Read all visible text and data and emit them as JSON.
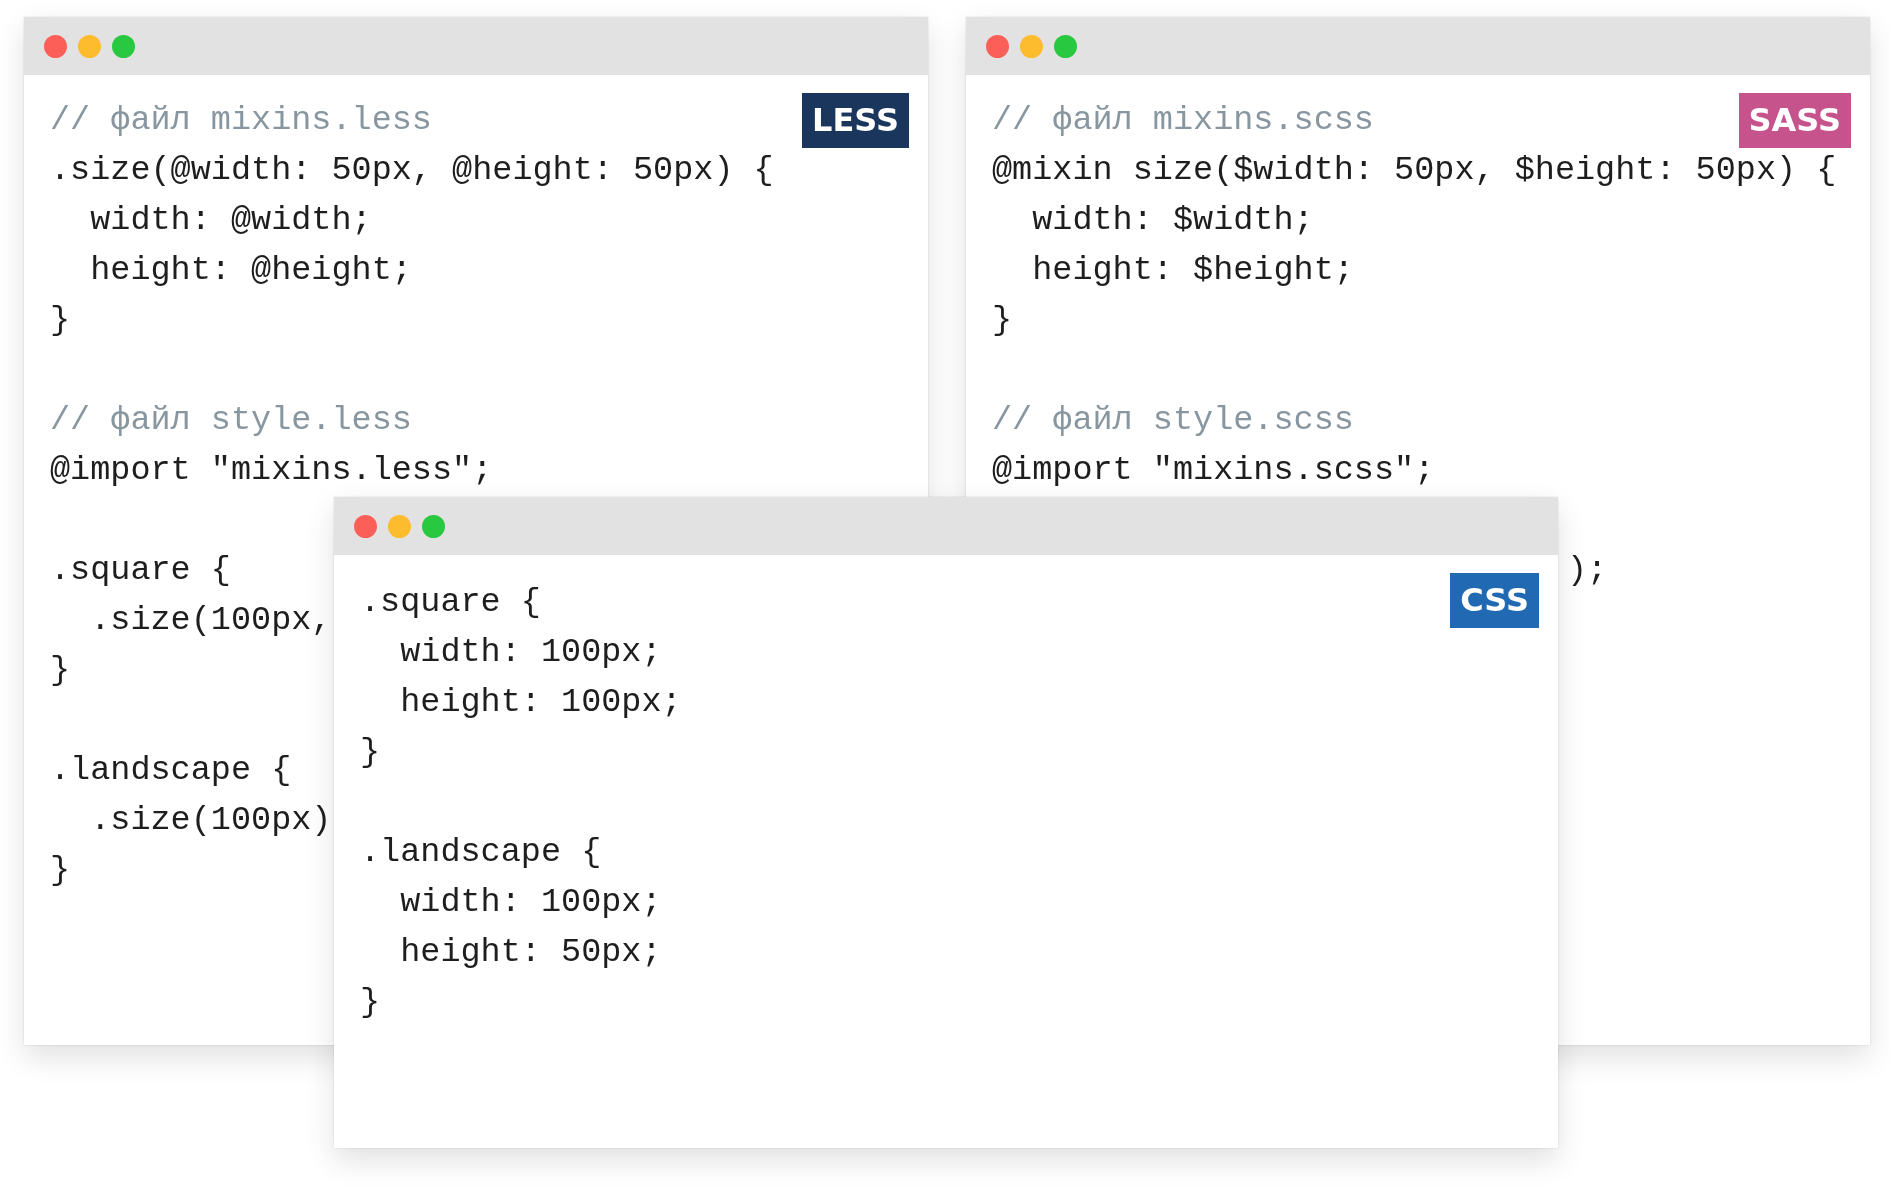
{
  "windows": [
    {
      "badge": {
        "label": "LESS",
        "color": "#1b365d"
      },
      "blocks": [
        [
          {
            "kind": "comment",
            "text": "// файл mixins.less"
          },
          {
            "kind": "code",
            "text": ".size(@width: 50px, @height: 50px) {"
          },
          {
            "kind": "code",
            "text": "  width: @width;"
          },
          {
            "kind": "code",
            "text": "  height: @height;"
          },
          {
            "kind": "code",
            "text": "}"
          }
        ],
        [
          {
            "kind": "comment",
            "text": "// файл style.less"
          },
          {
            "kind": "code",
            "text": "@import \"mixins.less\";"
          }
        ],
        [
          {
            "kind": "code",
            "text": ".square {"
          },
          {
            "kind": "code",
            "text": "  .size(100px,"
          },
          {
            "kind": "code",
            "text": "}"
          }
        ],
        [
          {
            "kind": "code",
            "text": ".landscape {"
          },
          {
            "kind": "code",
            "text": "  .size(100px)"
          },
          {
            "kind": "code",
            "text": "}"
          }
        ]
      ]
    },
    {
      "badge": {
        "label": "SASS",
        "color": "#c6538c"
      },
      "blocks": [
        [
          {
            "kind": "comment",
            "text": "// файл mixins.scss"
          },
          {
            "kind": "code",
            "text": "@mixin size($width: 50px, $height: 50px) {"
          },
          {
            "kind": "code",
            "text": "  width: $width;"
          },
          {
            "kind": "code",
            "text": "  height: $height;"
          },
          {
            "kind": "code",
            "text": "}"
          }
        ],
        [
          {
            "kind": "comment",
            "text": "// файл style.scss"
          },
          {
            "kind": "code",
            "text": "@import \"mixins.scss\";"
          }
        ],
        [
          {
            "kind": "fragment",
            "text": ");"
          }
        ]
      ]
    },
    {
      "badge": {
        "label": "CSS",
        "color": "#2169b3"
      },
      "blocks": [
        [
          {
            "kind": "code",
            "text": ".square {"
          },
          {
            "kind": "code",
            "text": "  width: 100px;"
          },
          {
            "kind": "code",
            "text": "  height: 100px;"
          },
          {
            "kind": "code",
            "text": "}"
          }
        ],
        [
          {
            "kind": "code",
            "text": ".landscape {"
          },
          {
            "kind": "code",
            "text": "  width: 100px;"
          },
          {
            "kind": "code",
            "text": "  height: 50px;"
          },
          {
            "kind": "code",
            "text": "}"
          }
        ]
      ]
    }
  ]
}
